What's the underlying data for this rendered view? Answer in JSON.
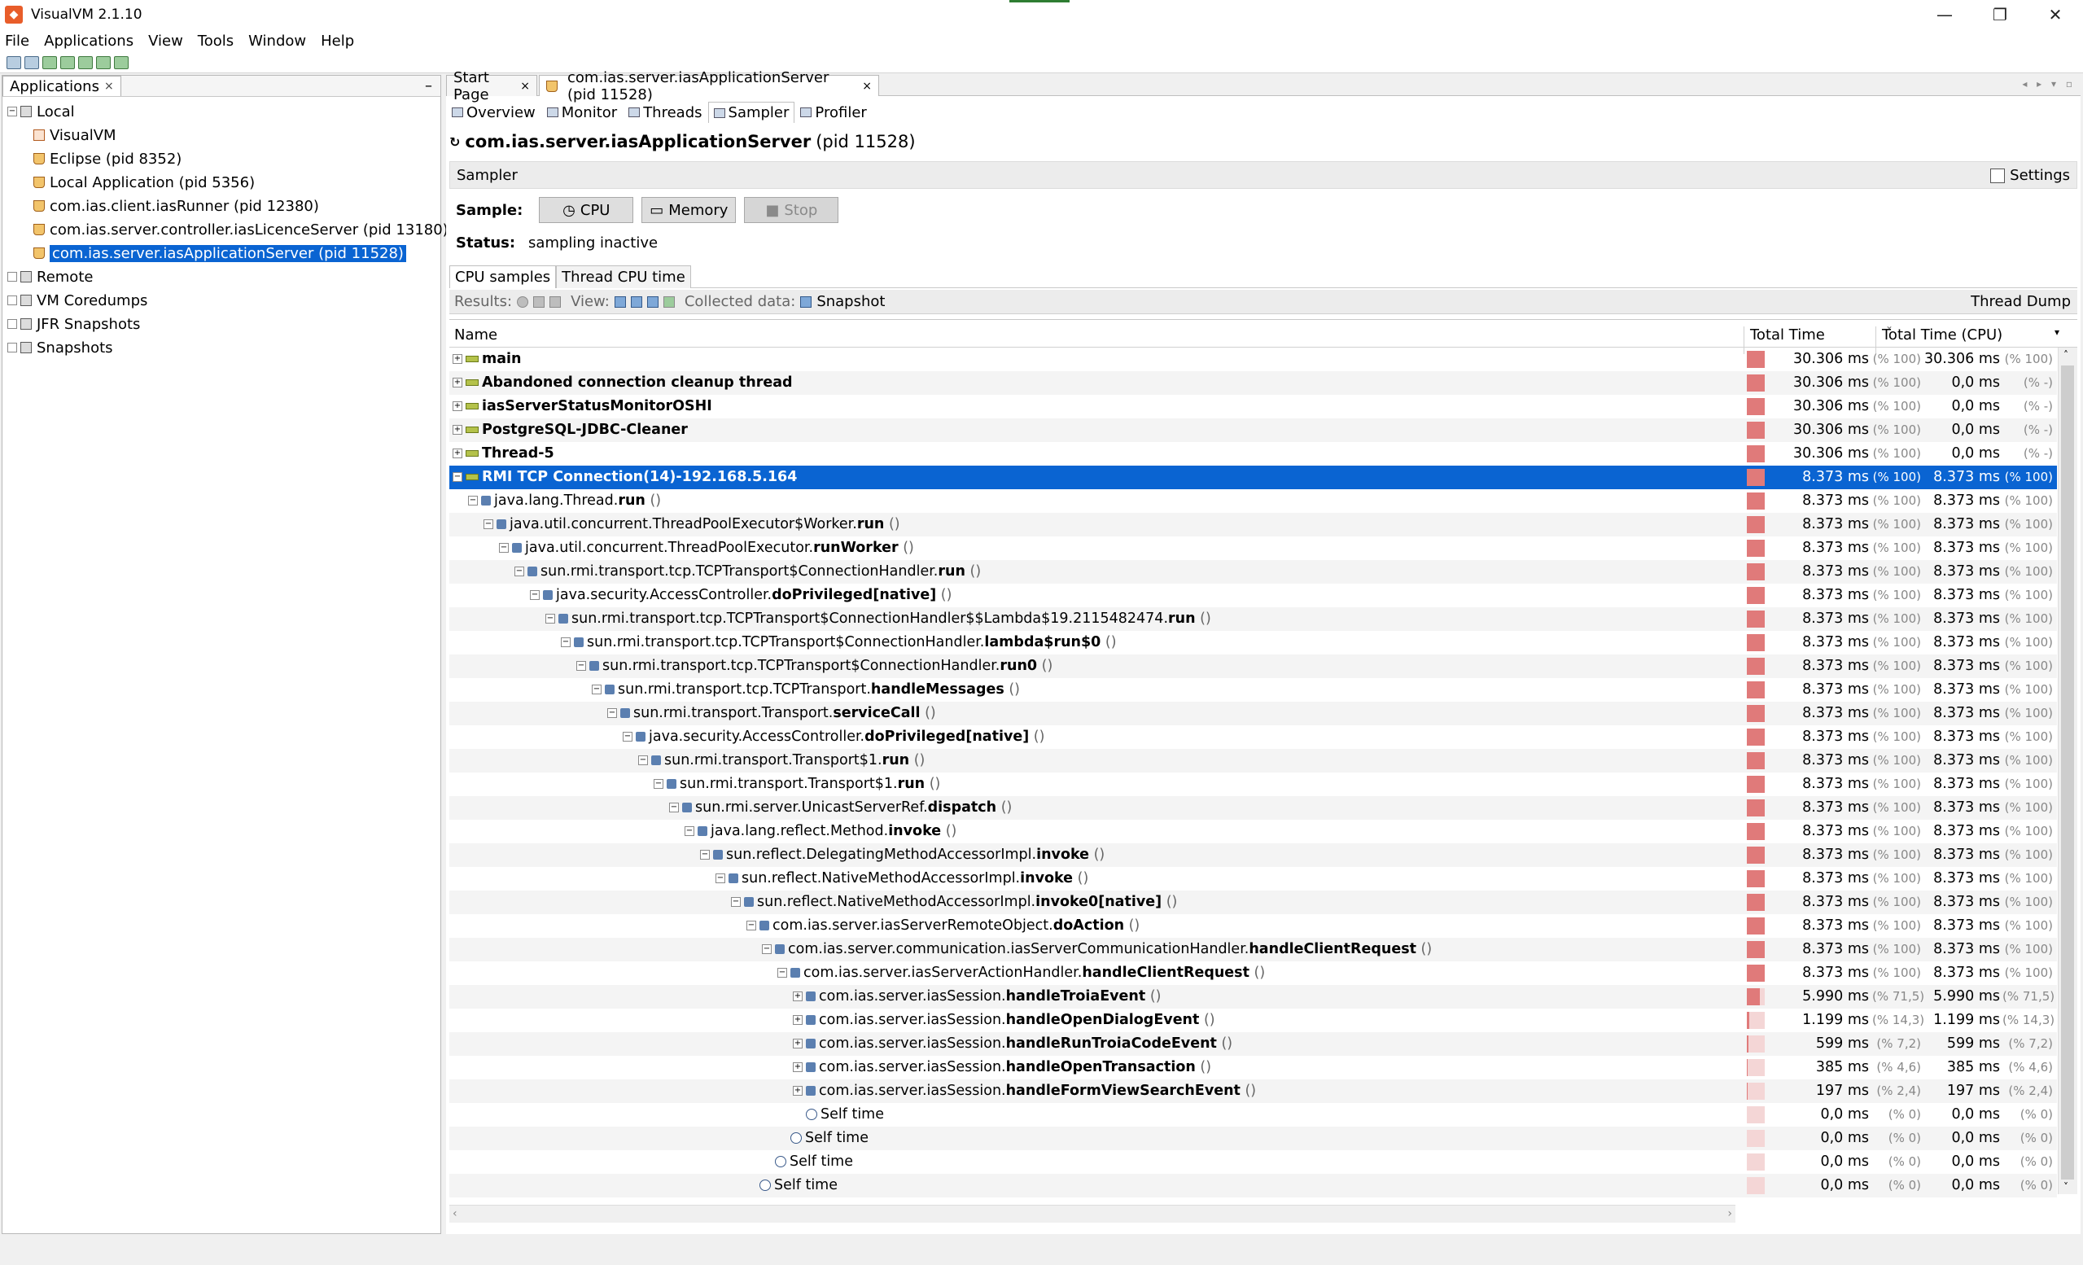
{
  "window": {
    "title": "VisualVM 2.1.10",
    "controls": [
      "—",
      "❐",
      "✕"
    ]
  },
  "menu": [
    "File",
    "Applications",
    "View",
    "Tools",
    "Window",
    "Help"
  ],
  "left": {
    "tab": "Applications",
    "tree": [
      {
        "label": "Local",
        "indent": 0,
        "icon": "computer-icon"
      },
      {
        "label": "VisualVM",
        "indent": 1,
        "icon": "visualvm-icon"
      },
      {
        "label": "Eclipse (pid 8352)",
        "indent": 1,
        "icon": "java-icon"
      },
      {
        "label": "Local Application (pid 5356)",
        "indent": 1,
        "icon": "java-icon"
      },
      {
        "label": "com.ias.client.iasRunner (pid 12380)",
        "indent": 1,
        "icon": "java-icon"
      },
      {
        "label": "com.ias.server.controller.iasLicenceServer (pid 13180)",
        "indent": 1,
        "icon": "java-icon"
      },
      {
        "label": "com.ias.server.iasApplicationServer (pid 11528)",
        "indent": 1,
        "icon": "java-icon",
        "selected": true
      },
      {
        "label": "Remote",
        "indent": 0,
        "icon": "remote-icon"
      },
      {
        "label": "VM Coredumps",
        "indent": 0,
        "icon": "coredump-icon"
      },
      {
        "label": "JFR Snapshots",
        "indent": 0,
        "icon": "jfr-icon"
      },
      {
        "label": "Snapshots",
        "indent": 0,
        "icon": "snapshot-icon"
      }
    ]
  },
  "doctabs": [
    "Start Page",
    "com.ias.server.iasApplicationServer (pid 11528)"
  ],
  "subtabs": [
    "Overview",
    "Monitor",
    "Threads",
    "Sampler",
    "Profiler"
  ],
  "heading": {
    "name": "com.ias.server.iasApplicationServer",
    "pid": "(pid 11528)"
  },
  "sampler": {
    "section": "Sampler",
    "settings": "Settings",
    "sample_label": "Sample:",
    "cpu": "CPU",
    "memory": "Memory",
    "stop": "Stop",
    "status_label": "Status:",
    "status": "sampling inactive"
  },
  "result_tabs": [
    "CPU samples",
    "Thread CPU time"
  ],
  "resbar": {
    "results": "Results:",
    "view": "View:",
    "collected": "Collected data:",
    "snapshot": "Snapshot",
    "thread_dump": "Thread Dump"
  },
  "columns": {
    "name": "Name",
    "total": "Total Time",
    "cpu": "Total Time (CPU)"
  },
  "rows": [
    {
      "d": 0,
      "k": "thread",
      "exp": "+",
      "pre": "",
      "b": "main",
      "suf": "",
      "t": "30.306 ms",
      "tp": "(% 100)",
      "c": "30.306 ms",
      "cp": "(% 100)",
      "bar": 100
    },
    {
      "d": 0,
      "k": "thread",
      "exp": "+",
      "pre": "",
      "b": "Abandoned connection cleanup thread",
      "suf": "",
      "t": "30.306 ms",
      "tp": "(% 100)",
      "c": "0,0 ms",
      "cp": "(% -)",
      "bar": 100
    },
    {
      "d": 0,
      "k": "thread",
      "exp": "+",
      "pre": "",
      "b": "iasServerStatusMonitorOSHI",
      "suf": "",
      "t": "30.306 ms",
      "tp": "(% 100)",
      "c": "0,0 ms",
      "cp": "(% -)",
      "bar": 100
    },
    {
      "d": 0,
      "k": "thread",
      "exp": "+",
      "pre": "",
      "b": "PostgreSQL-JDBC-Cleaner",
      "suf": "",
      "t": "30.306 ms",
      "tp": "(% 100)",
      "c": "0,0 ms",
      "cp": "(% -)",
      "bar": 100
    },
    {
      "d": 0,
      "k": "thread",
      "exp": "+",
      "pre": "",
      "b": "Thread-5",
      "suf": "",
      "t": "30.306 ms",
      "tp": "(% 100)",
      "c": "0,0 ms",
      "cp": "(% -)",
      "bar": 100
    },
    {
      "d": 0,
      "k": "thread",
      "exp": "−",
      "pre": "",
      "b": "RMI TCP Connection(14)-192.168.5.164",
      "suf": "",
      "t": "8.373 ms",
      "tp": "(% 100)",
      "c": "8.373 ms",
      "cp": "(% 100)",
      "bar": 100,
      "sel": true
    },
    {
      "d": 1,
      "k": "m",
      "exp": "−",
      "pre": "java.lang.Thread.",
      "b": "run",
      "suf": " ()",
      "t": "8.373 ms",
      "tp": "(% 100)",
      "c": "8.373 ms",
      "cp": "(% 100)",
      "bar": 100
    },
    {
      "d": 2,
      "k": "m",
      "exp": "−",
      "pre": "java.util.concurrent.ThreadPoolExecutor$Worker.",
      "b": "run",
      "suf": " ()",
      "t": "8.373 ms",
      "tp": "(% 100)",
      "c": "8.373 ms",
      "cp": "(% 100)",
      "bar": 100
    },
    {
      "d": 3,
      "k": "m",
      "exp": "−",
      "pre": "java.util.concurrent.ThreadPoolExecutor.",
      "b": "runWorker",
      "suf": " ()",
      "t": "8.373 ms",
      "tp": "(% 100)",
      "c": "8.373 ms",
      "cp": "(% 100)",
      "bar": 100
    },
    {
      "d": 4,
      "k": "m",
      "exp": "−",
      "pre": "sun.rmi.transport.tcp.TCPTransport$ConnectionHandler.",
      "b": "run",
      "suf": " ()",
      "t": "8.373 ms",
      "tp": "(% 100)",
      "c": "8.373 ms",
      "cp": "(% 100)",
      "bar": 100
    },
    {
      "d": 5,
      "k": "m",
      "exp": "−",
      "pre": "java.security.AccessController.",
      "b": "doPrivileged[native]",
      "suf": " ()",
      "t": "8.373 ms",
      "tp": "(% 100)",
      "c": "8.373 ms",
      "cp": "(% 100)",
      "bar": 100
    },
    {
      "d": 6,
      "k": "m",
      "exp": "−",
      "pre": "sun.rmi.transport.tcp.TCPTransport$ConnectionHandler$$Lambda$19.2115482474.",
      "b": "run",
      "suf": " ()",
      "t": "8.373 ms",
      "tp": "(% 100)",
      "c": "8.373 ms",
      "cp": "(% 100)",
      "bar": 100
    },
    {
      "d": 7,
      "k": "m",
      "exp": "−",
      "pre": "sun.rmi.transport.tcp.TCPTransport$ConnectionHandler.",
      "b": "lambda$run$0",
      "suf": " ()",
      "t": "8.373 ms",
      "tp": "(% 100)",
      "c": "8.373 ms",
      "cp": "(% 100)",
      "bar": 100
    },
    {
      "d": 8,
      "k": "m",
      "exp": "−",
      "pre": "sun.rmi.transport.tcp.TCPTransport$ConnectionHandler.",
      "b": "run0",
      "suf": " ()",
      "t": "8.373 ms",
      "tp": "(% 100)",
      "c": "8.373 ms",
      "cp": "(% 100)",
      "bar": 100
    },
    {
      "d": 9,
      "k": "m",
      "exp": "−",
      "pre": "sun.rmi.transport.tcp.TCPTransport.",
      "b": "handleMessages",
      "suf": " ()",
      "t": "8.373 ms",
      "tp": "(% 100)",
      "c": "8.373 ms",
      "cp": "(% 100)",
      "bar": 100
    },
    {
      "d": 10,
      "k": "m",
      "exp": "−",
      "pre": "sun.rmi.transport.Transport.",
      "b": "serviceCall",
      "suf": " ()",
      "t": "8.373 ms",
      "tp": "(% 100)",
      "c": "8.373 ms",
      "cp": "(% 100)",
      "bar": 100
    },
    {
      "d": 11,
      "k": "m",
      "exp": "−",
      "pre": "java.security.AccessController.",
      "b": "doPrivileged[native]",
      "suf": " ()",
      "t": "8.373 ms",
      "tp": "(% 100)",
      "c": "8.373 ms",
      "cp": "(% 100)",
      "bar": 100
    },
    {
      "d": 12,
      "k": "m",
      "exp": "−",
      "pre": "sun.rmi.transport.Transport$1.",
      "b": "run",
      "suf": " ()",
      "t": "8.373 ms",
      "tp": "(% 100)",
      "c": "8.373 ms",
      "cp": "(% 100)",
      "bar": 100
    },
    {
      "d": 13,
      "k": "m",
      "exp": "−",
      "pre": "sun.rmi.transport.Transport$1.",
      "b": "run",
      "suf": " ()",
      "t": "8.373 ms",
      "tp": "(% 100)",
      "c": "8.373 ms",
      "cp": "(% 100)",
      "bar": 100
    },
    {
      "d": 14,
      "k": "m",
      "exp": "−",
      "pre": "sun.rmi.server.UnicastServerRef.",
      "b": "dispatch",
      "suf": " ()",
      "t": "8.373 ms",
      "tp": "(% 100)",
      "c": "8.373 ms",
      "cp": "(% 100)",
      "bar": 100
    },
    {
      "d": 15,
      "k": "m",
      "exp": "−",
      "pre": "java.lang.reflect.Method.",
      "b": "invoke",
      "suf": " ()",
      "t": "8.373 ms",
      "tp": "(% 100)",
      "c": "8.373 ms",
      "cp": "(% 100)",
      "bar": 100
    },
    {
      "d": 16,
      "k": "m",
      "exp": "−",
      "pre": "sun.reflect.DelegatingMethodAccessorImpl.",
      "b": "invoke",
      "suf": " ()",
      "t": "8.373 ms",
      "tp": "(% 100)",
      "c": "8.373 ms",
      "cp": "(% 100)",
      "bar": 100
    },
    {
      "d": 17,
      "k": "m",
      "exp": "−",
      "pre": "sun.reflect.NativeMethodAccessorImpl.",
      "b": "invoke",
      "suf": " ()",
      "t": "8.373 ms",
      "tp": "(% 100)",
      "c": "8.373 ms",
      "cp": "(% 100)",
      "bar": 100
    },
    {
      "d": 18,
      "k": "m",
      "exp": "−",
      "pre": "sun.reflect.NativeMethodAccessorImpl.",
      "b": "invoke0[native]",
      "suf": " ()",
      "t": "8.373 ms",
      "tp": "(% 100)",
      "c": "8.373 ms",
      "cp": "(% 100)",
      "bar": 100
    },
    {
      "d": 19,
      "k": "m",
      "exp": "−",
      "pre": "com.ias.server.iasServerRemoteObject.",
      "b": "doAction",
      "suf": " ()",
      "t": "8.373 ms",
      "tp": "(% 100)",
      "c": "8.373 ms",
      "cp": "(% 100)",
      "bar": 100
    },
    {
      "d": 20,
      "k": "m",
      "exp": "−",
      "pre": "com.ias.server.communication.iasServerCommunicationHandler.",
      "b": "handleClientRequest",
      "suf": " ()",
      "t": "8.373 ms",
      "tp": "(% 100)",
      "c": "8.373 ms",
      "cp": "(% 100)",
      "bar": 100
    },
    {
      "d": 21,
      "k": "m",
      "exp": "−",
      "pre": "com.ias.server.iasServerActionHandler.",
      "b": "handleClientRequest",
      "suf": " ()",
      "t": "8.373 ms",
      "tp": "(% 100)",
      "c": "8.373 ms",
      "cp": "(% 100)",
      "bar": 100
    },
    {
      "d": 22,
      "k": "m",
      "exp": "+",
      "pre": "com.ias.server.iasSession.",
      "b": "handleTroiaEvent",
      "suf": " ()",
      "t": "5.990 ms",
      "tp": "(% 71,5)",
      "c": "5.990 ms",
      "cp": "(% 71,5)",
      "bar": 71.5
    },
    {
      "d": 22,
      "k": "m",
      "exp": "+",
      "pre": "com.ias.server.iasSession.",
      "b": "handleOpenDialogEvent",
      "suf": " ()",
      "t": "1.199 ms",
      "tp": "(% 14,3)",
      "c": "1.199 ms",
      "cp": "(% 14,3)",
      "bar": 14.3
    },
    {
      "d": 22,
      "k": "m",
      "exp": "+",
      "pre": "com.ias.server.iasSession.",
      "b": "handleRunTroiaCodeEvent",
      "suf": " ()",
      "t": "599 ms",
      "tp": "(% 7,2)",
      "c": "599 ms",
      "cp": "(% 7,2)",
      "bar": 7.2
    },
    {
      "d": 22,
      "k": "m",
      "exp": "+",
      "pre": "com.ias.server.iasSession.",
      "b": "handleOpenTransaction",
      "suf": " ()",
      "t": "385 ms",
      "tp": "(% 4,6)",
      "c": "385 ms",
      "cp": "(% 4,6)",
      "bar": 4.6
    },
    {
      "d": 22,
      "k": "m",
      "exp": "+",
      "pre": "com.ias.server.iasSession.",
      "b": "handleFormViewSearchEvent",
      "suf": " ()",
      "t": "197 ms",
      "tp": "(% 2,4)",
      "c": "197 ms",
      "cp": "(% 2,4)",
      "bar": 2.4
    },
    {
      "d": 22,
      "k": "self",
      "exp": "",
      "pre": "Self time",
      "b": "",
      "suf": "",
      "t": "0,0 ms",
      "tp": "(% 0)",
      "c": "0,0 ms",
      "cp": "(% 0)",
      "bar": 0
    },
    {
      "d": 21,
      "k": "self",
      "exp": "",
      "pre": "Self time",
      "b": "",
      "suf": "",
      "t": "0,0 ms",
      "tp": "(% 0)",
      "c": "0,0 ms",
      "cp": "(% 0)",
      "bar": 0
    },
    {
      "d": 20,
      "k": "self",
      "exp": "",
      "pre": "Self time",
      "b": "",
      "suf": "",
      "t": "0,0 ms",
      "tp": "(% 0)",
      "c": "0,0 ms",
      "cp": "(% 0)",
      "bar": 0
    },
    {
      "d": 19,
      "k": "self",
      "exp": "",
      "pre": "Self time",
      "b": "",
      "suf": "",
      "t": "0,0 ms",
      "tp": "(% 0)",
      "c": "0,0 ms",
      "cp": "(% 0)",
      "bar": 0
    }
  ]
}
